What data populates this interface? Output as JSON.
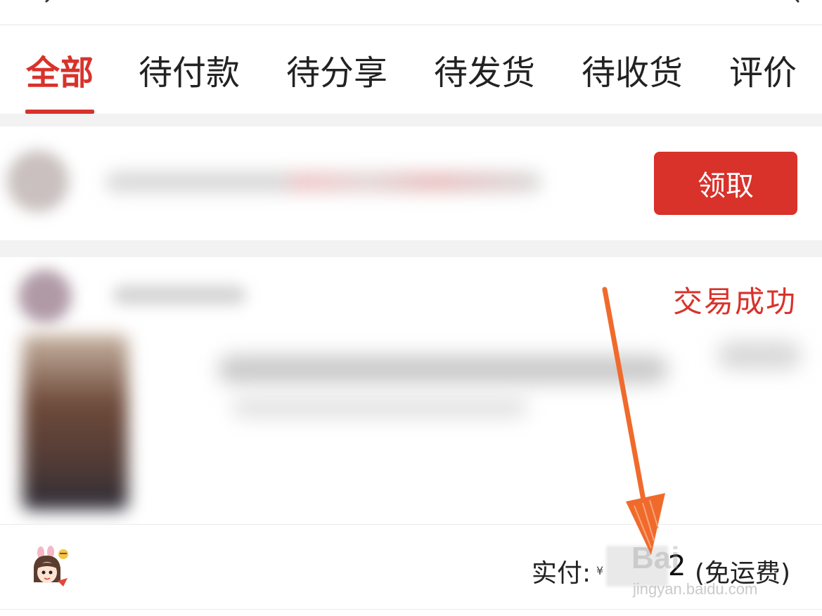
{
  "tabs": [
    {
      "label": "全部",
      "active": true
    },
    {
      "label": "待付款",
      "active": false
    },
    {
      "label": "待分享",
      "active": false
    },
    {
      "label": "待发货",
      "active": false
    },
    {
      "label": "待收货",
      "active": false
    },
    {
      "label": "评价",
      "active": false
    }
  ],
  "coupon": {
    "button_label": "领取"
  },
  "order": {
    "status": "交易成功",
    "pay_label": "实付:",
    "currency": "¥",
    "amount_visible_tail": "2",
    "shipping_note": "(免运费)"
  },
  "watermark": {
    "brand": "Bai",
    "site": "jingyan.baidu.com"
  },
  "colors": {
    "accent": "#d8322b",
    "annotation": "#f06a2c"
  },
  "icons": [
    "back-icon",
    "search-icon",
    "sticker-avatar",
    "arrow-annotation"
  ]
}
